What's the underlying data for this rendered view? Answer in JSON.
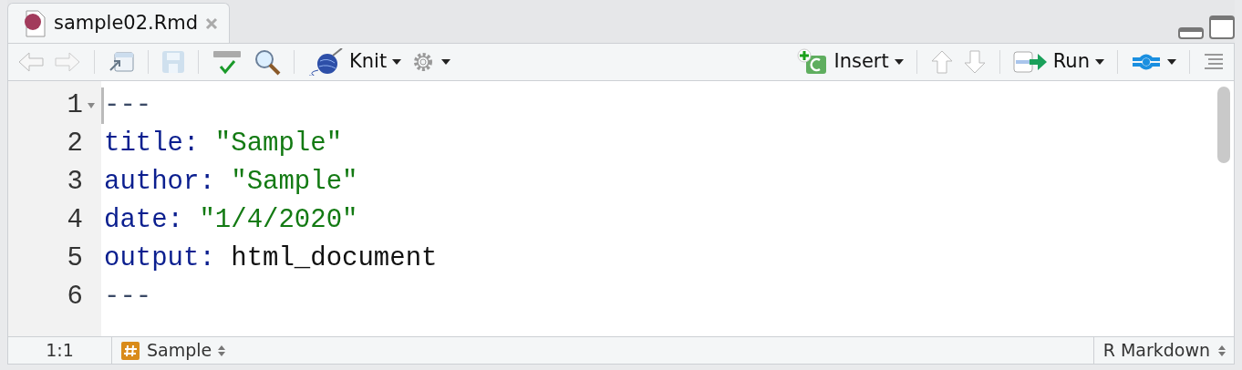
{
  "tabs": [
    {
      "label": "sample02.Rmd",
      "selected": true
    }
  ],
  "toolbar": {
    "knit": "Knit",
    "insert": "Insert",
    "run": "Run"
  },
  "lines": [
    {
      "number": "1",
      "fold": true,
      "cursor": true,
      "tokens": [
        {
          "kind": "delim",
          "text": "---"
        }
      ]
    },
    {
      "number": "2",
      "fold": false,
      "cursor": false,
      "tokens": [
        {
          "kind": "key",
          "text": "title:"
        },
        {
          "kind": "string",
          "text": "\"Sample\""
        }
      ]
    },
    {
      "number": "3",
      "fold": false,
      "cursor": false,
      "tokens": [
        {
          "kind": "key",
          "text": "author:"
        },
        {
          "kind": "string",
          "text": "\"Sample\""
        }
      ]
    },
    {
      "number": "4",
      "fold": false,
      "cursor": false,
      "tokens": [
        {
          "kind": "key",
          "text": "date:"
        },
        {
          "kind": "string",
          "text": "\"1/4/2020\""
        }
      ]
    },
    {
      "number": "5",
      "fold": false,
      "cursor": false,
      "tokens": [
        {
          "kind": "key",
          "text": "output:"
        },
        {
          "kind": "plain",
          "text": "html_document"
        }
      ]
    },
    {
      "number": "6",
      "fold": false,
      "cursor": false,
      "tokens": [
        {
          "kind": "delim",
          "text": "---"
        }
      ]
    }
  ],
  "status_bar": {
    "position": "1:1",
    "scope": "Sample",
    "mode": "R Markdown"
  }
}
